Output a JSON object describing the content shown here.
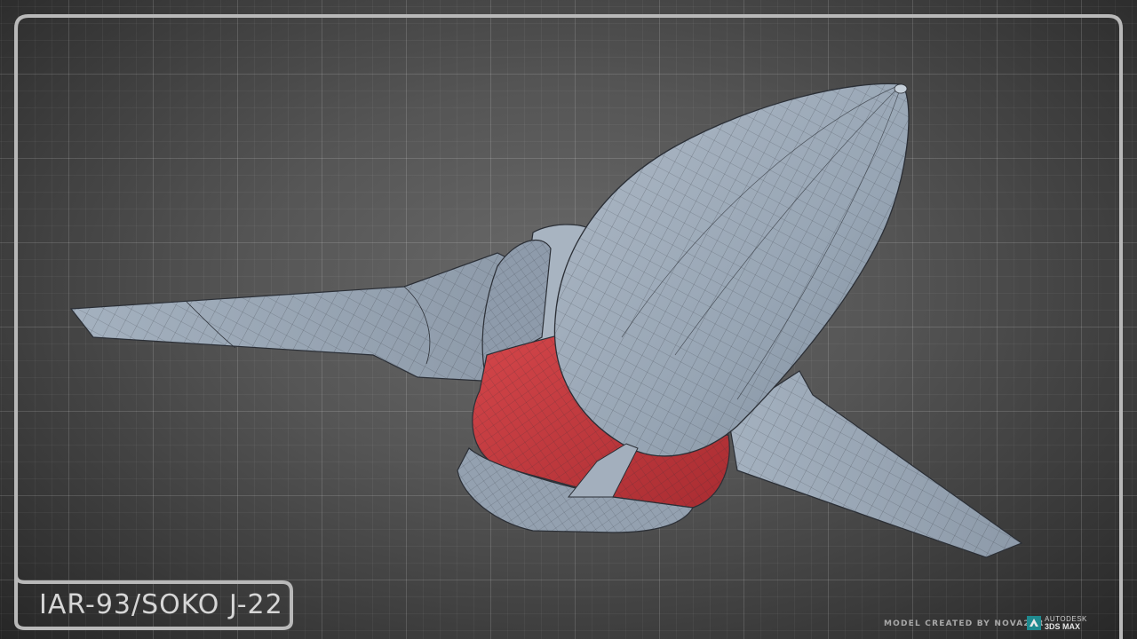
{
  "title": "IAR-93/SOKO J-22",
  "credit": "MODEL CREATED BY NOVA29R",
  "badge": {
    "brand": "AUTODESK",
    "product": "3DS MAX",
    "icon": "3ds-max-logo-icon"
  },
  "colors": {
    "background": "#4f4f4f",
    "frame": "#b9b9b9",
    "model_surface": "#9ba9b8",
    "model_accent": "#c4383d",
    "wire": "#2b2f36"
  }
}
